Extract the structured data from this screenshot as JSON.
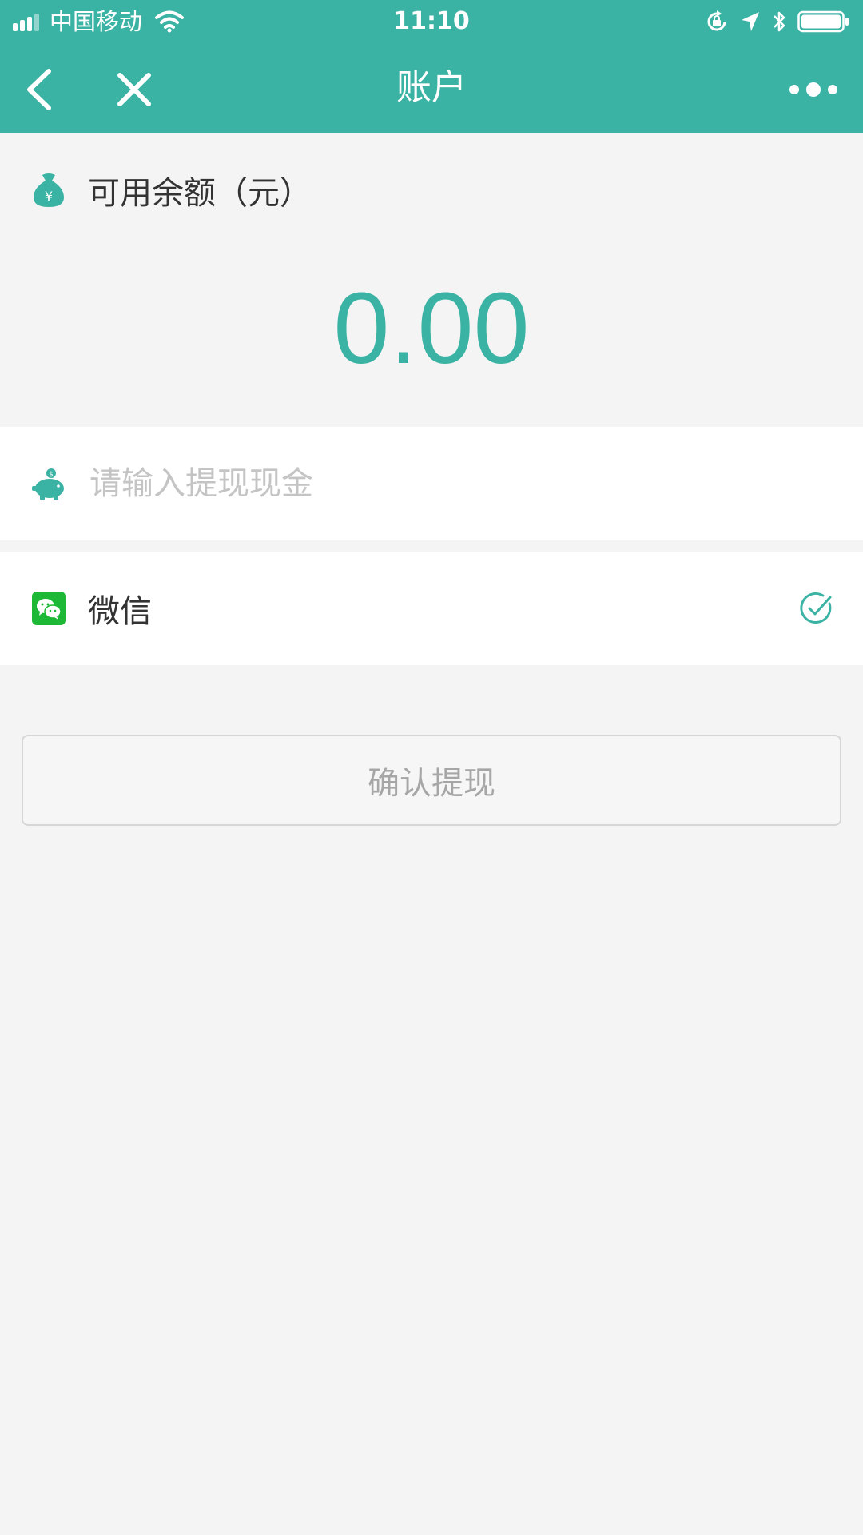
{
  "status_bar": {
    "carrier": "中国移动",
    "time": "11:10"
  },
  "nav": {
    "title": "账户"
  },
  "balance": {
    "label": "可用余额（元）",
    "amount": "0.00"
  },
  "withdraw_input": {
    "placeholder": "请输入提现现金",
    "value": ""
  },
  "payment": {
    "method_label": "微信",
    "selected": true
  },
  "confirm_button": {
    "label": "确认提现"
  },
  "colors": {
    "brand": "#3bb3a4",
    "wechat": "#1db836",
    "background": "#f4f4f4"
  }
}
